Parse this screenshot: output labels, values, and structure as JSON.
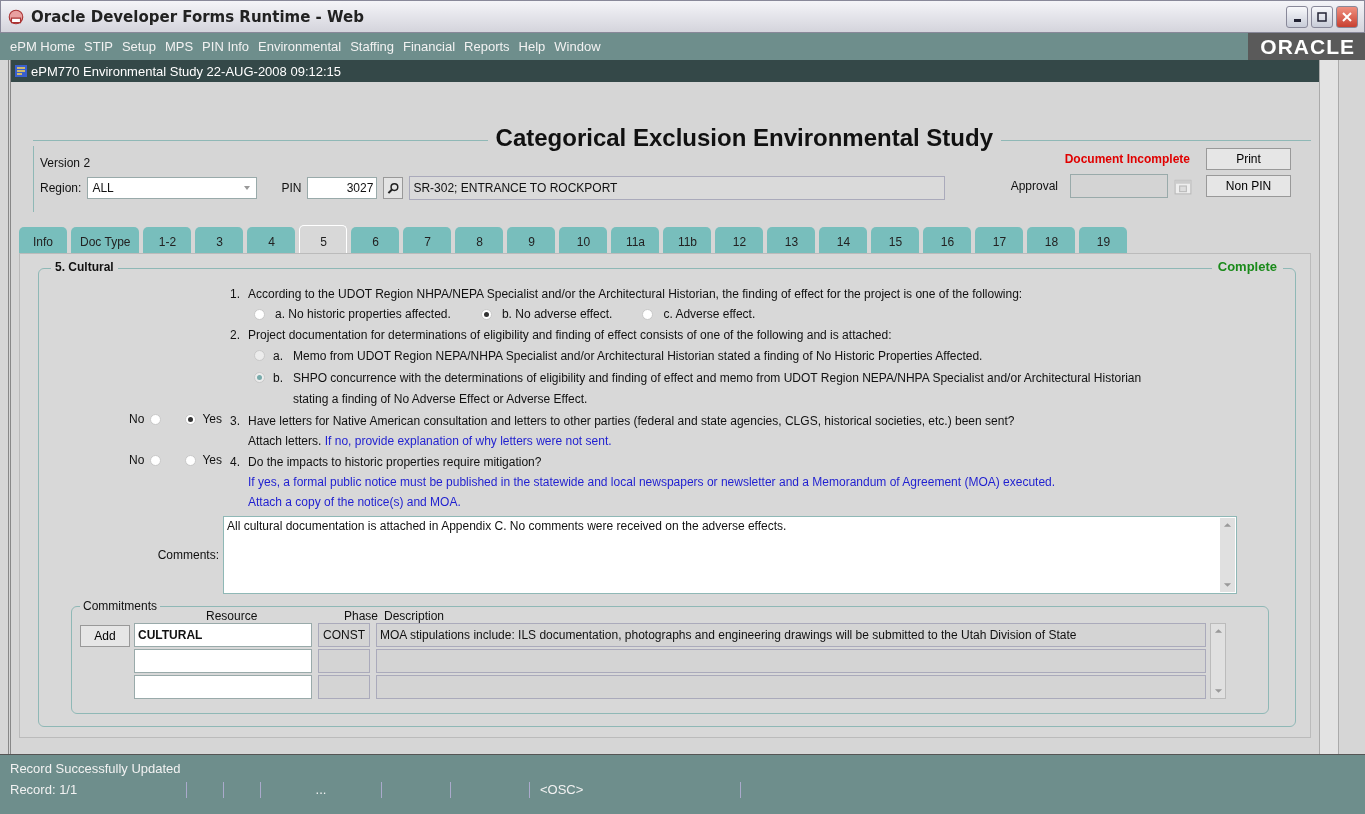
{
  "window": {
    "title": "Oracle Developer Forms Runtime - Web"
  },
  "menu": [
    "ePM Home",
    "STIP",
    "Setup",
    "MPS",
    "PIN Info",
    "Environmental",
    "Staffing",
    "Financial",
    "Reports",
    "Help",
    "Window"
  ],
  "logo": "ORACLE",
  "form_window": {
    "title": "ePM770 Environmental Study  22-AUG-2008 09:12:15"
  },
  "header": {
    "title": "Categorical Exclusion Environmental Study",
    "version_label": "Version",
    "version": "2",
    "region_label": "Region:",
    "region": "ALL",
    "pin_label": "PIN",
    "pin": "3027",
    "project": "SR-302; ENTRANCE TO ROCKPORT",
    "doc_status": "Document Incomplete",
    "approval_label": "Approval",
    "buttons": [
      "Print",
      "Non PIN"
    ]
  },
  "tabs": [
    {
      "label": "Info",
      "selected": false
    },
    {
      "label": "Doc Type",
      "selected": false
    },
    {
      "label": "1-2",
      "selected": false
    },
    {
      "label": "3",
      "selected": false
    },
    {
      "label": "4",
      "selected": false
    },
    {
      "label": "5",
      "selected": true
    },
    {
      "label": "6",
      "selected": false
    },
    {
      "label": "7",
      "selected": false
    },
    {
      "label": "8",
      "selected": false
    },
    {
      "label": "9",
      "selected": false
    },
    {
      "label": "10",
      "selected": false
    },
    {
      "label": "11a",
      "selected": false
    },
    {
      "label": "11b",
      "selected": false
    },
    {
      "label": "12",
      "selected": false
    },
    {
      "label": "13",
      "selected": false
    },
    {
      "label": "14",
      "selected": false
    },
    {
      "label": "15",
      "selected": false
    },
    {
      "label": "16",
      "selected": false
    },
    {
      "label": "17",
      "selected": false
    },
    {
      "label": "18",
      "selected": false
    },
    {
      "label": "19",
      "selected": false
    }
  ],
  "section": {
    "title": "5. Cultural",
    "status": "Complete",
    "questions": [
      {
        "kind": "inline_options",
        "number": "1.",
        "text": "According to the UDOT Region NHPA/NEPA Specialist and/or the Architectural Historian, the finding of effect for the project is one of the following:",
        "disabled": false,
        "options": [
          {
            "label": "a. No historic properties affected.",
            "selected": false
          },
          {
            "label": "b. No adverse effect.",
            "selected": true
          },
          {
            "label": "c. Adverse effect.",
            "selected": false
          }
        ]
      },
      {
        "kind": "stacked_options",
        "number": "2.",
        "text": "Project documentation for determinations of eligibility and finding of effect consists of one of the following and is attached:",
        "disabled": true,
        "options": [
          {
            "letter": "a.",
            "label": "Memo from UDOT Region NEPA/NHPA Specialist and/or Architectural Historian stated a finding of No Historic Properties Affected.",
            "selected": false
          },
          {
            "letter": "b.",
            "label": "SHPO concurrence with the determinations of eligibility and finding of effect and memo from UDOT Region NEPA/NHPA Specialist and/or Architectural Historian stating a finding of No Adverse Effect or Adverse Effect.",
            "selected": true
          }
        ]
      },
      {
        "kind": "yes_no",
        "number": "3.",
        "text": "Have letters for Native American consultation and letters to other parties (federal and state agencies, CLGS, historical societies, etc.)  been sent?",
        "text2": "Attach letters.",
        "note": "If no, provide explanation of why letters were not sent.",
        "answers": [
          {
            "label": "No",
            "selected": false
          },
          {
            "label": "Yes",
            "selected": true
          }
        ]
      },
      {
        "kind": "yes_no",
        "number": "4.",
        "text": "Do the impacts to historic properties require mitigation?",
        "note_lines": [
          "If yes, a formal public notice must be published in the statewide and local newspapers or newsletter and a Memorandum of Agreement (MOA) executed.",
          "Attach a copy of the notice(s) and MOA."
        ],
        "answers": [
          {
            "label": "No",
            "selected": false
          },
          {
            "label": "Yes",
            "selected": false
          }
        ]
      }
    ],
    "comments_label": "Comments:",
    "comments": "All cultural documentation is attached in Appendix C. No comments were received on the adverse effects.",
    "commitments": {
      "title": "Commitments",
      "add": "Add",
      "columns": [
        "Resource",
        "Phase",
        "Description"
      ],
      "rows": [
        {
          "resource": "CULTURAL",
          "phase": "CONST",
          "description": "MOA stipulations include: ILS documentation, photographs and engineering drawings will be submitted to the Utah Division of State"
        },
        {
          "resource": "",
          "phase": "",
          "description": ""
        },
        {
          "resource": "",
          "phase": "",
          "description": ""
        }
      ]
    }
  },
  "status_bar": {
    "message": "Record Successfully Updated",
    "record": "Record: 1/1",
    "cells": [
      "...",
      "<OSC>"
    ]
  }
}
